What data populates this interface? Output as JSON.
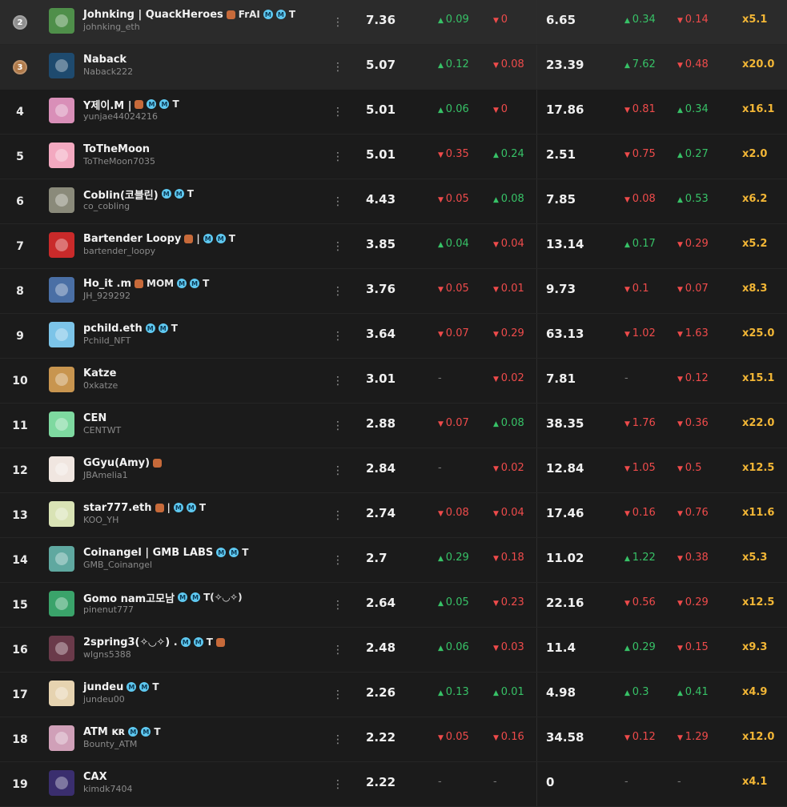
{
  "leaderboard": {
    "rows": [
      {
        "rank": "2",
        "name": "Johnking | QuackHeroes",
        "handle": "johnking_eth",
        "score1": "7.36",
        "c1": {
          "dir": "up",
          "val": "0.09"
        },
        "c2": {
          "dir": "down",
          "val": "0"
        },
        "score2": "6.65",
        "c3": {
          "dir": "up",
          "val": "0.34"
        },
        "c4": {
          "dir": "down",
          "val": "0.14"
        },
        "mult": "x5.1",
        "badges": [
          "emoji",
          "FrAI",
          "M",
          "M",
          "T"
        ],
        "avatar": "#4f8f4a",
        "medal": "silver"
      },
      {
        "rank": "3",
        "name": "Naback",
        "handle": "Naback222",
        "score1": "5.07",
        "c1": {
          "dir": "up",
          "val": "0.12"
        },
        "c2": {
          "dir": "down",
          "val": "0.08"
        },
        "score2": "23.39",
        "c3": {
          "dir": "up",
          "val": "7.62"
        },
        "c4": {
          "dir": "down",
          "val": "0.48"
        },
        "mult": "x20.0",
        "badges": [],
        "avatar": "#1e4a6e",
        "medal": "bronze"
      },
      {
        "rank": "4",
        "name": "Y제이.M |",
        "handle": "yunjae44024216",
        "score1": "5.01",
        "c1": {
          "dir": "up",
          "val": "0.06"
        },
        "c2": {
          "dir": "down",
          "val": "0"
        },
        "score2": "17.86",
        "c3": {
          "dir": "down",
          "val": "0.81"
        },
        "c4": {
          "dir": "up",
          "val": "0.34"
        },
        "mult": "x16.1",
        "badges": [
          "emoji",
          "M",
          "M",
          "T"
        ],
        "avatar": "#d98fb8"
      },
      {
        "rank": "5",
        "name": "ToTheMoon",
        "handle": "ToTheMoon7035",
        "score1": "5.01",
        "c1": {
          "dir": "down",
          "val": "0.35"
        },
        "c2": {
          "dir": "up",
          "val": "0.24"
        },
        "score2": "2.51",
        "c3": {
          "dir": "down",
          "val": "0.75"
        },
        "c4": {
          "dir": "up",
          "val": "0.27"
        },
        "mult": "x2.0",
        "badges": [],
        "avatar": "#f3a9c0"
      },
      {
        "rank": "6",
        "name": "Coblin(코블린)",
        "handle": "co_cobling",
        "score1": "4.43",
        "c1": {
          "dir": "down",
          "val": "0.05"
        },
        "c2": {
          "dir": "up",
          "val": "0.08"
        },
        "score2": "7.85",
        "c3": {
          "dir": "down",
          "val": "0.08"
        },
        "c4": {
          "dir": "up",
          "val": "0.53"
        },
        "mult": "x6.2",
        "badges": [
          "M",
          "M",
          "T"
        ],
        "avatar": "#8a8a7a"
      },
      {
        "rank": "7",
        "name": "Bartender Loopy",
        "handle": "bartender_loopy",
        "score1": "3.85",
        "c1": {
          "dir": "up",
          "val": "0.04"
        },
        "c2": {
          "dir": "down",
          "val": "0.04"
        },
        "score2": "13.14",
        "c3": {
          "dir": "up",
          "val": "0.17"
        },
        "c4": {
          "dir": "down",
          "val": "0.29"
        },
        "mult": "x5.2",
        "badges": [
          "emoji",
          "|",
          "M",
          "M",
          "T"
        ],
        "avatar": "#c92a2a"
      },
      {
        "rank": "8",
        "name": "Ho_it .m",
        "handle": "JH_929292",
        "score1": "3.76",
        "c1": {
          "dir": "down",
          "val": "0.05"
        },
        "c2": {
          "dir": "down",
          "val": "0.01"
        },
        "score2": "9.73",
        "c3": {
          "dir": "down",
          "val": "0.1"
        },
        "c4": {
          "dir": "down",
          "val": "0.07"
        },
        "mult": "x8.3",
        "badges": [
          "emoji",
          "MOM",
          "M",
          "M",
          "T"
        ],
        "avatar": "#4a6fa5"
      },
      {
        "rank": "9",
        "name": "pchild.eth",
        "handle": "Pchild_NFT",
        "score1": "3.64",
        "c1": {
          "dir": "down",
          "val": "0.07"
        },
        "c2": {
          "dir": "down",
          "val": "0.29"
        },
        "score2": "63.13",
        "c3": {
          "dir": "down",
          "val": "1.02"
        },
        "c4": {
          "dir": "down",
          "val": "1.63"
        },
        "mult": "x25.0",
        "badges": [
          "M",
          "M",
          "T"
        ],
        "avatar": "#7cc4e8"
      },
      {
        "rank": "10",
        "name": "Katze",
        "handle": "0xkatze",
        "score1": "3.01",
        "c1": {
          "dir": "none",
          "val": "-"
        },
        "c2": {
          "dir": "down",
          "val": "0.02"
        },
        "score2": "7.81",
        "c3": {
          "dir": "none",
          "val": "-"
        },
        "c4": {
          "dir": "down",
          "val": "0.12"
        },
        "mult": "x15.1",
        "badges": [],
        "avatar": "#c8954f"
      },
      {
        "rank": "11",
        "name": "CEN",
        "handle": "CENTWT",
        "score1": "2.88",
        "c1": {
          "dir": "down",
          "val": "0.07"
        },
        "c2": {
          "dir": "up",
          "val": "0.08"
        },
        "score2": "38.35",
        "c3": {
          "dir": "down",
          "val": "1.76"
        },
        "c4": {
          "dir": "down",
          "val": "0.36"
        },
        "mult": "x22.0",
        "badges": [],
        "avatar": "#7ed9a0"
      },
      {
        "rank": "12",
        "name": "GGyu(Amy)",
        "handle": "JBAmelia1",
        "score1": "2.84",
        "c1": {
          "dir": "none",
          "val": "-"
        },
        "c2": {
          "dir": "down",
          "val": "0.02"
        },
        "score2": "12.84",
        "c3": {
          "dir": "down",
          "val": "1.05"
        },
        "c4": {
          "dir": "down",
          "val": "0.5"
        },
        "mult": "x12.5",
        "badges": [
          "emoji"
        ],
        "avatar": "#f0e6e0"
      },
      {
        "rank": "13",
        "name": "star777.eth",
        "handle": "KOO_YH",
        "score1": "2.74",
        "c1": {
          "dir": "down",
          "val": "0.08"
        },
        "c2": {
          "dir": "down",
          "val": "0.04"
        },
        "score2": "17.46",
        "c3": {
          "dir": "down",
          "val": "0.16"
        },
        "c4": {
          "dir": "down",
          "val": "0.76"
        },
        "mult": "x11.6",
        "badges": [
          "emoji",
          "|",
          "M",
          "M",
          "T"
        ],
        "avatar": "#d9e3b5"
      },
      {
        "rank": "14",
        "name": "Coinangel | GMB LABS",
        "handle": "GMB_Coinangel",
        "score1": "2.7",
        "c1": {
          "dir": "up",
          "val": "0.29"
        },
        "c2": {
          "dir": "down",
          "val": "0.18"
        },
        "score2": "11.02",
        "c3": {
          "dir": "up",
          "val": "1.22"
        },
        "c4": {
          "dir": "down",
          "val": "0.38"
        },
        "mult": "x5.3",
        "badges": [
          "M",
          "M",
          "T"
        ],
        "avatar": "#5fa8a0"
      },
      {
        "rank": "15",
        "name": "Gomo nam고모남",
        "handle": "pinenut777",
        "score1": "2.64",
        "c1": {
          "dir": "up",
          "val": "0.05"
        },
        "c2": {
          "dir": "down",
          "val": "0.23"
        },
        "score2": "22.16",
        "c3": {
          "dir": "down",
          "val": "0.56"
        },
        "c4": {
          "dir": "down",
          "val": "0.29"
        },
        "mult": "x12.5",
        "badges": [
          "M",
          "M",
          "T(✧◡✧)"
        ],
        "avatar": "#3aa36a"
      },
      {
        "rank": "16",
        "name": "2spring3(✧◡✧) .",
        "handle": "wlgns5388",
        "score1": "2.48",
        "c1": {
          "dir": "up",
          "val": "0.06"
        },
        "c2": {
          "dir": "down",
          "val": "0.03"
        },
        "score2": "11.4",
        "c3": {
          "dir": "up",
          "val": "0.29"
        },
        "c4": {
          "dir": "down",
          "val": "0.15"
        },
        "mult": "x9.3",
        "badges": [
          "M",
          "M",
          "T",
          "emoji"
        ],
        "avatar": "#6a3a4a"
      },
      {
        "rank": "17",
        "name": "jundeu",
        "handle": "jundeu00",
        "score1": "2.26",
        "c1": {
          "dir": "up",
          "val": "0.13"
        },
        "c2": {
          "dir": "up",
          "val": "0.01"
        },
        "score2": "4.98",
        "c3": {
          "dir": "up",
          "val": "0.3"
        },
        "c4": {
          "dir": "up",
          "val": "0.41"
        },
        "mult": "x4.9",
        "badges": [
          "M",
          "M",
          "T"
        ],
        "avatar": "#e6d3b0"
      },
      {
        "rank": "18",
        "name": "ATM ᴋʀ",
        "handle": "Bounty_ATM",
        "score1": "2.22",
        "c1": {
          "dir": "down",
          "val": "0.05"
        },
        "c2": {
          "dir": "down",
          "val": "0.16"
        },
        "score2": "34.58",
        "c3": {
          "dir": "down",
          "val": "0.12"
        },
        "c4": {
          "dir": "down",
          "val": "1.29"
        },
        "mult": "x12.0",
        "badges": [
          "M",
          "M",
          "T"
        ],
        "avatar": "#d0a0b8"
      },
      {
        "rank": "19",
        "name": "CAX",
        "handle": "kimdk7404",
        "score1": "2.22",
        "c1": {
          "dir": "none",
          "val": "-"
        },
        "c2": {
          "dir": "none",
          "val": "-"
        },
        "score2": "0",
        "c3": {
          "dir": "none",
          "val": "-"
        },
        "c4": {
          "dir": "none",
          "val": "-"
        },
        "mult": "x4.1",
        "badges": [],
        "avatar": "#3a2e6e"
      }
    ]
  },
  "colors": {
    "up": "#37c267",
    "down": "#ef4b4b",
    "multiplier": "#f2b636",
    "badge": "#5ec8f0",
    "medal_silver": "#8f8f8f",
    "medal_bronze": "#b07a4a"
  },
  "icons": {
    "menu": "kebab-menu-icon",
    "up": "triangle-up-icon",
    "down": "triangle-down-icon",
    "medal": "medal-icon"
  }
}
